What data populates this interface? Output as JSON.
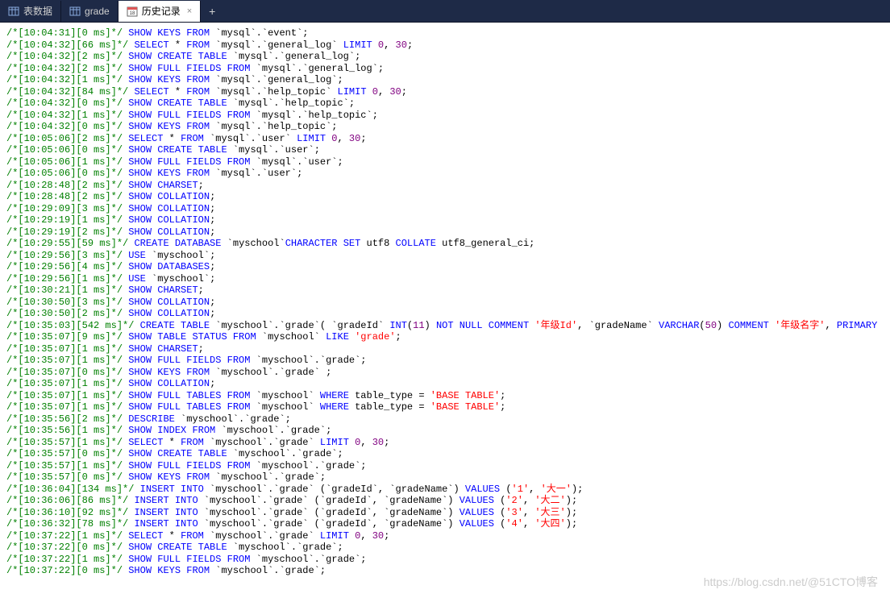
{
  "tabs": {
    "tab1": "表数据",
    "tab2": "grade",
    "tab3": "历史记录",
    "add": "+"
  },
  "watermark": "https://blog.csdn.net/@51CTO博客",
  "log": [
    {
      "t": "/*[10:04:31][0 ms]*/",
      "tokens": [
        {
          "c": "keyword",
          "v": "SHOW KEYS FROM"
        },
        {
          "c": "ident",
          "v": " `mysql`.`event`"
        }
      ],
      "end": ";"
    },
    {
      "t": "/*[10:04:32][66 ms]*/",
      "tokens": [
        {
          "c": "keyword",
          "v": "SELECT"
        },
        {
          "c": "ident",
          "v": " * "
        },
        {
          "c": "keyword",
          "v": "FROM"
        },
        {
          "c": "ident",
          "v": " `mysql`.`general_log` "
        },
        {
          "c": "keyword",
          "v": "LIMIT"
        },
        {
          "c": "num",
          "v": " 0"
        },
        {
          "c": "ident",
          "v": ", "
        },
        {
          "c": "num",
          "v": "30"
        }
      ],
      "end": ";"
    },
    {
      "t": "/*[10:04:32][2 ms]*/",
      "tokens": [
        {
          "c": "keyword",
          "v": "SHOW CREATE TABLE"
        },
        {
          "c": "ident",
          "v": " `mysql`.`general_log`"
        }
      ],
      "end": ";"
    },
    {
      "t": "/*[10:04:32][2 ms]*/",
      "tokens": [
        {
          "c": "keyword",
          "v": "SHOW FULL FIELDS FROM"
        },
        {
          "c": "ident",
          "v": " `mysql`.`general_log`"
        }
      ],
      "end": ";"
    },
    {
      "t": "/*[10:04:32][1 ms]*/",
      "tokens": [
        {
          "c": "keyword",
          "v": "SHOW KEYS FROM"
        },
        {
          "c": "ident",
          "v": " `mysql`.`general_log`"
        }
      ],
      "end": ";"
    },
    {
      "t": "/*[10:04:32][84 ms]*/",
      "tokens": [
        {
          "c": "keyword",
          "v": "SELECT"
        },
        {
          "c": "ident",
          "v": " * "
        },
        {
          "c": "keyword",
          "v": "FROM"
        },
        {
          "c": "ident",
          "v": " `mysql`.`help_topic` "
        },
        {
          "c": "keyword",
          "v": "LIMIT"
        },
        {
          "c": "num",
          "v": " 0"
        },
        {
          "c": "ident",
          "v": ", "
        },
        {
          "c": "num",
          "v": "30"
        }
      ],
      "end": ";"
    },
    {
      "t": "/*[10:04:32][0 ms]*/",
      "tokens": [
        {
          "c": "keyword",
          "v": "SHOW CREATE TABLE"
        },
        {
          "c": "ident",
          "v": " `mysql`.`help_topic`"
        }
      ],
      "end": ";"
    },
    {
      "t": "/*[10:04:32][1 ms]*/",
      "tokens": [
        {
          "c": "keyword",
          "v": "SHOW FULL FIELDS FROM"
        },
        {
          "c": "ident",
          "v": " `mysql`.`help_topic`"
        }
      ],
      "end": ";"
    },
    {
      "t": "/*[10:04:32][0 ms]*/",
      "tokens": [
        {
          "c": "keyword",
          "v": "SHOW KEYS FROM"
        },
        {
          "c": "ident",
          "v": " `mysql`.`help_topic`"
        }
      ],
      "end": ";"
    },
    {
      "t": "/*[10:05:06][2 ms]*/",
      "tokens": [
        {
          "c": "keyword",
          "v": "SELECT"
        },
        {
          "c": "ident",
          "v": " * "
        },
        {
          "c": "keyword",
          "v": "FROM"
        },
        {
          "c": "ident",
          "v": " `mysql`.`user` "
        },
        {
          "c": "keyword",
          "v": "LIMIT"
        },
        {
          "c": "num",
          "v": " 0"
        },
        {
          "c": "ident",
          "v": ", "
        },
        {
          "c": "num",
          "v": "30"
        }
      ],
      "end": ";"
    },
    {
      "t": "/*[10:05:06][0 ms]*/",
      "tokens": [
        {
          "c": "keyword",
          "v": "SHOW CREATE TABLE"
        },
        {
          "c": "ident",
          "v": " `mysql`.`user`"
        }
      ],
      "end": ";"
    },
    {
      "t": "/*[10:05:06][1 ms]*/",
      "tokens": [
        {
          "c": "keyword",
          "v": "SHOW FULL FIELDS FROM"
        },
        {
          "c": "ident",
          "v": " `mysql`.`user`"
        }
      ],
      "end": ";"
    },
    {
      "t": "/*[10:05:06][0 ms]*/",
      "tokens": [
        {
          "c": "keyword",
          "v": "SHOW KEYS FROM"
        },
        {
          "c": "ident",
          "v": " `mysql`.`user`"
        }
      ],
      "end": ";"
    },
    {
      "t": "/*[10:28:48][2 ms]*/",
      "tokens": [
        {
          "c": "keyword",
          "v": "SHOW CHARSET"
        }
      ],
      "end": ";"
    },
    {
      "t": "/*[10:28:48][2 ms]*/",
      "tokens": [
        {
          "c": "keyword",
          "v": "SHOW COLLATION"
        }
      ],
      "end": ";"
    },
    {
      "t": "/*[10:29:09][3 ms]*/",
      "tokens": [
        {
          "c": "keyword",
          "v": "SHOW COLLATION"
        }
      ],
      "end": ";"
    },
    {
      "t": "/*[10:29:19][1 ms]*/",
      "tokens": [
        {
          "c": "keyword",
          "v": "SHOW COLLATION"
        }
      ],
      "end": ";"
    },
    {
      "t": "/*[10:29:19][2 ms]*/",
      "tokens": [
        {
          "c": "keyword",
          "v": "SHOW COLLATION"
        }
      ],
      "end": ";"
    },
    {
      "t": "/*[10:29:55][59 ms]*/",
      "tokens": [
        {
          "c": "keyword",
          "v": "CREATE DATABASE"
        },
        {
          "c": "ident",
          "v": " `myschool`"
        },
        {
          "c": "keyword",
          "v": "CHARACTER SET"
        },
        {
          "c": "ident",
          "v": " utf8 "
        },
        {
          "c": "keyword",
          "v": "COLLATE"
        },
        {
          "c": "ident",
          "v": " utf8_general_ci"
        }
      ],
      "end": ";"
    },
    {
      "t": "/*[10:29:56][3 ms]*/",
      "tokens": [
        {
          "c": "keyword",
          "v": "USE"
        },
        {
          "c": "ident",
          "v": " `myschool`"
        }
      ],
      "end": ";"
    },
    {
      "t": "/*[10:29:56][4 ms]*/",
      "tokens": [
        {
          "c": "keyword",
          "v": "SHOW DATABASES"
        }
      ],
      "end": ";"
    },
    {
      "t": "/*[10:29:56][1 ms]*/",
      "tokens": [
        {
          "c": "keyword",
          "v": "USE"
        },
        {
          "c": "ident",
          "v": " `myschool`"
        }
      ],
      "end": ";"
    },
    {
      "t": "/*[10:30:21][1 ms]*/",
      "tokens": [
        {
          "c": "keyword",
          "v": "SHOW CHARSET"
        }
      ],
      "end": ";"
    },
    {
      "t": "/*[10:30:50][3 ms]*/",
      "tokens": [
        {
          "c": "keyword",
          "v": "SHOW COLLATION"
        }
      ],
      "end": ";"
    },
    {
      "t": "/*[10:30:50][2 ms]*/",
      "tokens": [
        {
          "c": "keyword",
          "v": "SHOW COLLATION"
        }
      ],
      "end": ";"
    },
    {
      "t": "/*[10:35:03][542 ms]*/",
      "tokens": [
        {
          "c": "keyword",
          "v": "CREATE TABLE"
        },
        {
          "c": "ident",
          "v": " `myschool`.`grade`( `gradeId` "
        },
        {
          "c": "keyword",
          "v": "INT"
        },
        {
          "c": "ident",
          "v": "("
        },
        {
          "c": "num",
          "v": "11"
        },
        {
          "c": "ident",
          "v": ") "
        },
        {
          "c": "keyword",
          "v": "NOT NULL COMMENT"
        },
        {
          "c": "ident",
          "v": " "
        },
        {
          "c": "str",
          "v": "'年级Id'"
        },
        {
          "c": "ident",
          "v": ", `gradeName` "
        },
        {
          "c": "keyword",
          "v": "VARCHAR"
        },
        {
          "c": "ident",
          "v": "("
        },
        {
          "c": "num",
          "v": "50"
        },
        {
          "c": "ident",
          "v": ") "
        },
        {
          "c": "keyword",
          "v": "COMMENT"
        },
        {
          "c": "ident",
          "v": " "
        },
        {
          "c": "str",
          "v": "'年级名字'"
        },
        {
          "c": "ident",
          "v": ", "
        },
        {
          "c": "keyword",
          "v": "PRIMARY"
        }
      ],
      "end": ""
    },
    {
      "t": "/*[10:35:07][9 ms]*/",
      "tokens": [
        {
          "c": "keyword",
          "v": "SHOW TABLE STATUS FROM"
        },
        {
          "c": "ident",
          "v": " `myschool` "
        },
        {
          "c": "keyword",
          "v": "LIKE"
        },
        {
          "c": "ident",
          "v": " "
        },
        {
          "c": "str",
          "v": "'grade'"
        }
      ],
      "end": ";"
    },
    {
      "t": "/*[10:35:07][1 ms]*/",
      "tokens": [
        {
          "c": "keyword",
          "v": "SHOW CHARSET"
        }
      ],
      "end": ";"
    },
    {
      "t": "/*[10:35:07][1 ms]*/",
      "tokens": [
        {
          "c": "keyword",
          "v": "SHOW FULL FIELDS FROM"
        },
        {
          "c": "ident",
          "v": " `myschool`.`grade`"
        }
      ],
      "end": ";"
    },
    {
      "t": "/*[10:35:07][0 ms]*/",
      "tokens": [
        {
          "c": "keyword",
          "v": "SHOW KEYS FROM"
        },
        {
          "c": "ident",
          "v": " `myschool`.`grade` "
        }
      ],
      "end": ";"
    },
    {
      "t": "/*[10:35:07][1 ms]*/",
      "tokens": [
        {
          "c": "keyword",
          "v": "SHOW COLLATION"
        }
      ],
      "end": ";"
    },
    {
      "t": "/*[10:35:07][1 ms]*/",
      "tokens": [
        {
          "c": "keyword",
          "v": "SHOW FULL TABLES FROM"
        },
        {
          "c": "ident",
          "v": " `myschool` "
        },
        {
          "c": "keyword",
          "v": "WHERE"
        },
        {
          "c": "ident",
          "v": " table_type = "
        },
        {
          "c": "str",
          "v": "'BASE TABLE'"
        }
      ],
      "end": ";"
    },
    {
      "t": "/*[10:35:07][1 ms]*/",
      "tokens": [
        {
          "c": "keyword",
          "v": "SHOW FULL TABLES FROM"
        },
        {
          "c": "ident",
          "v": " `myschool` "
        },
        {
          "c": "keyword",
          "v": "WHERE"
        },
        {
          "c": "ident",
          "v": " table_type = "
        },
        {
          "c": "str",
          "v": "'BASE TABLE'"
        }
      ],
      "end": ";"
    },
    {
      "t": "/*[10:35:56][2 ms]*/",
      "tokens": [
        {
          "c": "keyword",
          "v": "DESCRIBE"
        },
        {
          "c": "ident",
          "v": " `myschool`.`grade`"
        }
      ],
      "end": ";"
    },
    {
      "t": "/*[10:35:56][1 ms]*/",
      "tokens": [
        {
          "c": "keyword",
          "v": "SHOW INDEX FROM"
        },
        {
          "c": "ident",
          "v": " `myschool`.`grade`"
        }
      ],
      "end": ";"
    },
    {
      "t": "/*[10:35:57][1 ms]*/",
      "tokens": [
        {
          "c": "keyword",
          "v": "SELECT"
        },
        {
          "c": "ident",
          "v": " * "
        },
        {
          "c": "keyword",
          "v": "FROM"
        },
        {
          "c": "ident",
          "v": " `myschool`.`grade` "
        },
        {
          "c": "keyword",
          "v": "LIMIT"
        },
        {
          "c": "num",
          "v": " 0"
        },
        {
          "c": "ident",
          "v": ", "
        },
        {
          "c": "num",
          "v": "30"
        }
      ],
      "end": ";"
    },
    {
      "t": "/*[10:35:57][0 ms]*/",
      "tokens": [
        {
          "c": "keyword",
          "v": "SHOW CREATE TABLE"
        },
        {
          "c": "ident",
          "v": " `myschool`.`grade`"
        }
      ],
      "end": ";"
    },
    {
      "t": "/*[10:35:57][1 ms]*/",
      "tokens": [
        {
          "c": "keyword",
          "v": "SHOW FULL FIELDS FROM"
        },
        {
          "c": "ident",
          "v": " `myschool`.`grade`"
        }
      ],
      "end": ";"
    },
    {
      "t": "/*[10:35:57][0 ms]*/",
      "tokens": [
        {
          "c": "keyword",
          "v": "SHOW KEYS FROM"
        },
        {
          "c": "ident",
          "v": " `myschool`.`grade`"
        }
      ],
      "end": ";"
    },
    {
      "t": "/*[10:36:04][134 ms]*/",
      "tokens": [
        {
          "c": "keyword",
          "v": "INSERT INTO"
        },
        {
          "c": "ident",
          "v": " `myschool`.`grade` (`gradeId`, `gradeName`) "
        },
        {
          "c": "keyword",
          "v": "VALUES"
        },
        {
          "c": "ident",
          "v": " ("
        },
        {
          "c": "str",
          "v": "'1'"
        },
        {
          "c": "ident",
          "v": ", "
        },
        {
          "c": "str",
          "v": "'大一'"
        },
        {
          "c": "ident",
          "v": ")"
        }
      ],
      "end": ";"
    },
    {
      "t": "/*[10:36:06][86 ms]*/",
      "tokens": [
        {
          "c": "keyword",
          "v": "INSERT INTO"
        },
        {
          "c": "ident",
          "v": " `myschool`.`grade` (`gradeId`, `gradeName`) "
        },
        {
          "c": "keyword",
          "v": "VALUES"
        },
        {
          "c": "ident",
          "v": " ("
        },
        {
          "c": "str",
          "v": "'2'"
        },
        {
          "c": "ident",
          "v": ", "
        },
        {
          "c": "str",
          "v": "'大二'"
        },
        {
          "c": "ident",
          "v": ")"
        }
      ],
      "end": ";"
    },
    {
      "t": "/*[10:36:10][92 ms]*/",
      "tokens": [
        {
          "c": "keyword",
          "v": "INSERT INTO"
        },
        {
          "c": "ident",
          "v": " `myschool`.`grade` (`gradeId`, `gradeName`) "
        },
        {
          "c": "keyword",
          "v": "VALUES"
        },
        {
          "c": "ident",
          "v": " ("
        },
        {
          "c": "str",
          "v": "'3'"
        },
        {
          "c": "ident",
          "v": ", "
        },
        {
          "c": "str",
          "v": "'大三'"
        },
        {
          "c": "ident",
          "v": ")"
        }
      ],
      "end": ";"
    },
    {
      "t": "/*[10:36:32][78 ms]*/",
      "tokens": [
        {
          "c": "keyword",
          "v": "INSERT INTO"
        },
        {
          "c": "ident",
          "v": " `myschool`.`grade` (`gradeId`, `gradeName`) "
        },
        {
          "c": "keyword",
          "v": "VALUES"
        },
        {
          "c": "ident",
          "v": " ("
        },
        {
          "c": "str",
          "v": "'4'"
        },
        {
          "c": "ident",
          "v": ", "
        },
        {
          "c": "str",
          "v": "'大四'"
        },
        {
          "c": "ident",
          "v": ")"
        }
      ],
      "end": ";"
    },
    {
      "t": "/*[10:37:22][1 ms]*/",
      "tokens": [
        {
          "c": "keyword",
          "v": "SELECT"
        },
        {
          "c": "ident",
          "v": " * "
        },
        {
          "c": "keyword",
          "v": "FROM"
        },
        {
          "c": "ident",
          "v": " `myschool`.`grade` "
        },
        {
          "c": "keyword",
          "v": "LIMIT"
        },
        {
          "c": "num",
          "v": " 0"
        },
        {
          "c": "ident",
          "v": ", "
        },
        {
          "c": "num",
          "v": "30"
        }
      ],
      "end": ";"
    },
    {
      "t": "/*[10:37:22][0 ms]*/",
      "tokens": [
        {
          "c": "keyword",
          "v": "SHOW CREATE TABLE"
        },
        {
          "c": "ident",
          "v": " `myschool`.`grade`"
        }
      ],
      "end": ";"
    },
    {
      "t": "/*[10:37:22][1 ms]*/",
      "tokens": [
        {
          "c": "keyword",
          "v": "SHOW FULL FIELDS FROM"
        },
        {
          "c": "ident",
          "v": " `myschool`.`grade`"
        }
      ],
      "end": ";"
    },
    {
      "t": "/*[10:37:22][0 ms]*/",
      "tokens": [
        {
          "c": "keyword",
          "v": "SHOW KEYS FROM"
        },
        {
          "c": "ident",
          "v": " `myschool`.`grade`"
        }
      ],
      "end": ";"
    }
  ]
}
